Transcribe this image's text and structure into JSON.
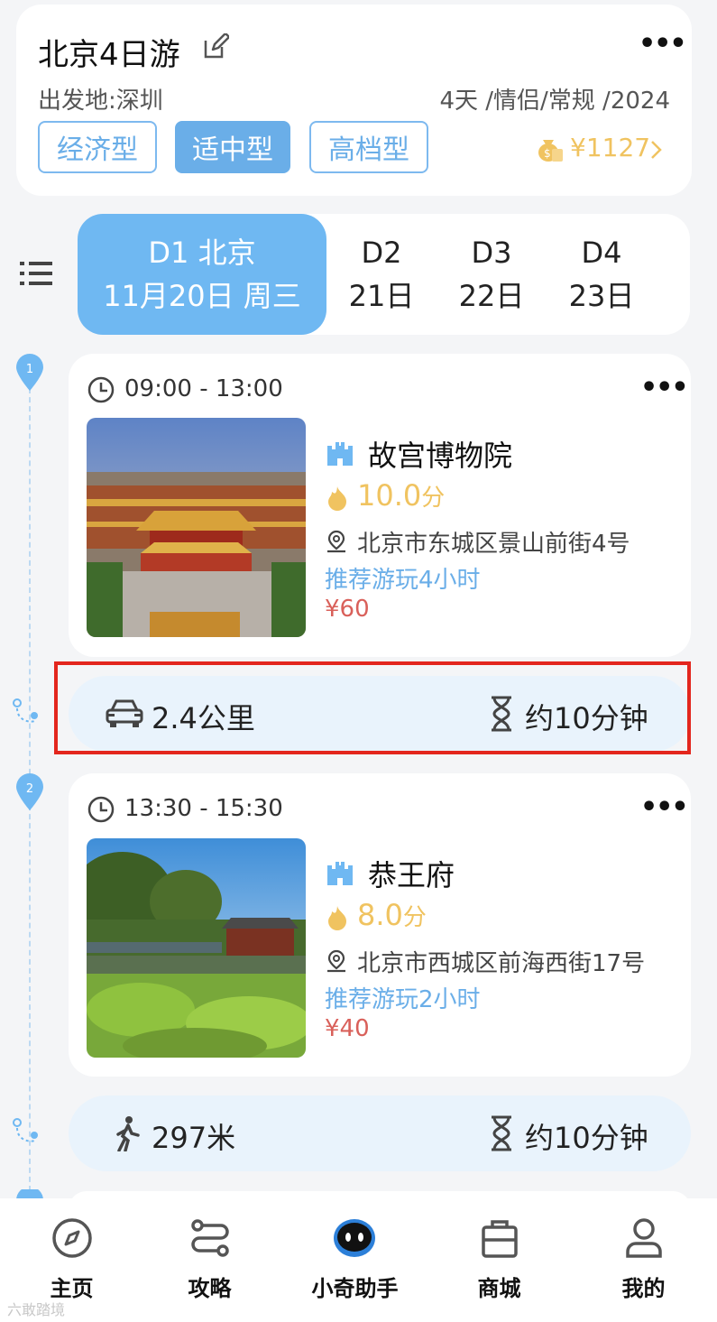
{
  "header": {
    "title": "北京4日游",
    "departure": "出发地:深圳",
    "meta": "4天 /情侣/常规 /2024",
    "plans": [
      "经济型",
      "适中型",
      "高档型"
    ],
    "active_plan": "适中型",
    "budget": "¥1127"
  },
  "days": [
    {
      "line1": "D1 北京",
      "line2": "11月20日 周三",
      "active": true
    },
    {
      "line1": "D2",
      "line2": "21日",
      "active": false
    },
    {
      "line1": "D3",
      "line2": "22日",
      "active": false
    },
    {
      "line1": "D4",
      "line2": "23日",
      "active": false
    }
  ],
  "stops": [
    {
      "index": "1",
      "time": "09:00 - 13:00",
      "name": "故宫博物院",
      "score": "10.0",
      "score_unit": "分",
      "address": "北京市东城区景山前街4号",
      "recommend": "推荐游玩4小时",
      "price": "¥60"
    },
    {
      "index": "2",
      "time": "13:30 - 15:30",
      "name": "恭王府",
      "score": "8.0",
      "score_unit": "分",
      "address": "北京市西城区前海西街17号",
      "recommend": "推荐游玩2小时",
      "price": "¥40"
    }
  ],
  "routes": [
    {
      "mode": "car-icon",
      "distance": "2.4公里",
      "duration": "约10分钟",
      "highlighted": true
    },
    {
      "mode": "walk-icon",
      "distance": "297米",
      "duration": "约10分钟",
      "highlighted": false
    }
  ],
  "nav": {
    "items": [
      {
        "label": "主页",
        "icon": "compass-icon"
      },
      {
        "label": "攻略",
        "icon": "route-icon"
      },
      {
        "label": "小奇助手",
        "icon": "robot-icon"
      },
      {
        "label": "商城",
        "icon": "bag-icon"
      },
      {
        "label": "我的",
        "icon": "user-icon"
      }
    ]
  },
  "watermark": "六敢踏境",
  "colors": {
    "accent": "#6fb8f2",
    "gold": "#f0c360",
    "price": "#d9605a",
    "highlight_box": "#e3261d"
  }
}
